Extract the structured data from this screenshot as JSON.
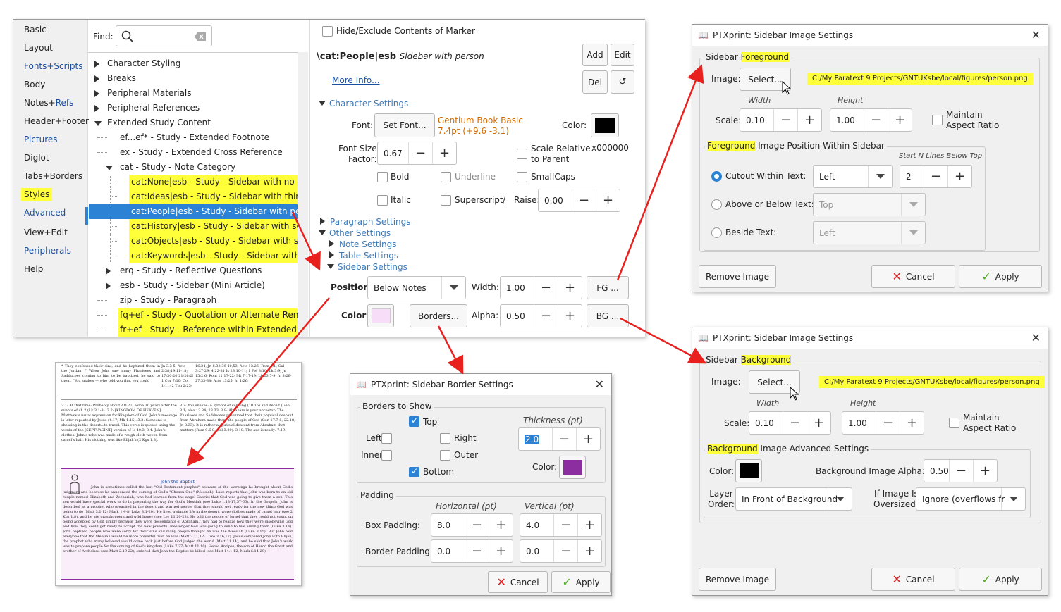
{
  "sidebar_nav": {
    "items": [
      {
        "label": "Basic",
        "color": "dark"
      },
      {
        "label": "Layout",
        "color": "dark"
      },
      {
        "label": "Fonts+Scripts",
        "color": "blue"
      },
      {
        "label": "Body",
        "color": "dark"
      },
      {
        "label": "Notes+Refs",
        "color": "mixed"
      },
      {
        "label": "Header+Footer",
        "color": "dark"
      },
      {
        "label": "Pictures",
        "color": "blue"
      },
      {
        "label": "Diglot",
        "color": "dark"
      },
      {
        "label": "Tabs+Borders",
        "color": "dark"
      },
      {
        "label": "Styles",
        "color": "highlight"
      },
      {
        "label": "Advanced",
        "color": "blue"
      },
      {
        "label": "View+Edit",
        "color": "dark"
      },
      {
        "label": "Peripherals",
        "color": "blue"
      },
      {
        "label": "Help",
        "color": "dark"
      }
    ],
    "notes_part1": "Notes+",
    "notes_part2": "Refs"
  },
  "find": {
    "label": "Find:",
    "value": ""
  },
  "tree": [
    {
      "label": "Character Styling",
      "level": 0,
      "exp": "closed"
    },
    {
      "label": "Breaks",
      "level": 0,
      "exp": "closed"
    },
    {
      "label": "Peripheral Materials",
      "level": 0,
      "exp": "closed"
    },
    {
      "label": "Peripheral References",
      "level": 0,
      "exp": "closed"
    },
    {
      "label": "Extended Study Content",
      "level": 0,
      "exp": "open"
    },
    {
      "label": "ef...ef* - Study - Extended Footnote",
      "level": 1,
      "exp": "none"
    },
    {
      "label": "ex - Study - Extended Cross Reference",
      "level": 1,
      "exp": "none"
    },
    {
      "label": "cat - Study - Note Category",
      "level": 1,
      "exp": "open"
    },
    {
      "label": "cat:None|esb - Study - Sidebar with no imag",
      "level": 2,
      "exp": "none",
      "hl": true
    },
    {
      "label": "cat:Ideas|esb - Study - Sidebar with thinking",
      "level": 2,
      "exp": "none",
      "hl": true
    },
    {
      "label": "cat:People|esb - Study - Sidebar with person",
      "level": 2,
      "exp": "none",
      "sel": true
    },
    {
      "label": "cat:History|esb - Study - Sidebar with scroll E",
      "level": 2,
      "exp": "none",
      "hl": true
    },
    {
      "label": "cat:Objects|esb - Study - Sidebar with shapes",
      "level": 2,
      "exp": "none",
      "hl": true
    },
    {
      "label": "cat:Keywords|esb - Study - Sidebar with key",
      "level": 2,
      "exp": "none",
      "hl": true
    },
    {
      "label": "erq - Study - Reflective Questions",
      "level": 1,
      "exp": "closed"
    },
    {
      "label": "esb - Study - Sidebar (Mini Article)",
      "level": 1,
      "exp": "closed"
    },
    {
      "label": "zip - Study - Paragraph",
      "level": 1,
      "exp": "none"
    },
    {
      "label": "fq+ef - Study - Quotation or Alternate Rendering",
      "level": 1,
      "exp": "none",
      "hl": true
    },
    {
      "label": "fr+ef - Study - Reference within Extended Footn",
      "level": 1,
      "exp": "none",
      "hl": true
    }
  ],
  "style_panel": {
    "hide_label": "Hide/Exclude Contents of Marker",
    "marker": "\\cat:People|esb",
    "marker_desc": "Sidebar with person",
    "add": "Add",
    "edit": "Edit",
    "del": "Del",
    "more_info": "More Info...",
    "char_settings": "Character Settings",
    "font_label": "Font:",
    "set_font": "Set Font...",
    "font_name": "Gentium Book Basic",
    "font_size": "7.4pt (+9.6 -3.1)",
    "color_label": "Color:",
    "color_hex": "x000000",
    "font_size_factor": "Font Size\nFactor:",
    "fsf_value": "0.67",
    "scale_relative": "Scale Relative\nto Parent",
    "bold": "Bold",
    "underline": "Underline",
    "smallcaps": "SmallCaps",
    "italic": "Italic",
    "superscript": "Superscript",
    "slash": "/",
    "raise": "Raise:",
    "raise_value": "0.00",
    "para_settings": "Paragraph Settings",
    "other_settings": "Other Settings",
    "note_settings": "Note Settings",
    "table_settings": "Table Settings",
    "sidebar_settings": "Sidebar Settings",
    "position_label": "Position:",
    "position_value": "Below Notes",
    "width_label": "Width:",
    "width_value": "1.00",
    "fg_btn": "FG ...",
    "color2_label": "Color:",
    "borders_btn": "Borders...",
    "alpha_label": "Alpha:",
    "alpha_value": "0.50",
    "bg_btn": "BG ..."
  },
  "fg_dialog": {
    "title": "PTXprint: Sidebar Image Settings",
    "group1_a": "Sidebar ",
    "group1_b": "Foreground",
    "image_label": "Image:",
    "select": "Select...",
    "path": "C:/My Paratext 9 Projects/GNTUKsbe/local/figures/person.png",
    "width_hdr": "Width",
    "height_hdr": "Height",
    "scale_label": "Scale:",
    "scale_w": "0.10",
    "scale_h": "1.00",
    "maintain": "Maintain\nAspect Ratio",
    "group2_a": "Foreground",
    "group2_b": " Image Position Within Sidebar",
    "start_n": "Start N Lines Below Top",
    "cutout": "Cutout Within Text:",
    "cutout_val": "Left",
    "cutout_n": "2",
    "above": "Above or Below Text:",
    "above_val": "Top",
    "beside": "Beside Text:",
    "beside_val": "Left",
    "remove": "Remove Image",
    "cancel": "Cancel",
    "apply": "Apply"
  },
  "bg_dialog": {
    "title": "PTXprint: Sidebar Image Settings",
    "group1_a": "Sidebar ",
    "group1_b": "Background",
    "image_label": "Image:",
    "select": "Select...",
    "path": "C:/My Paratext 9 Projects/GNTUKsbe/local/figures/person.png",
    "width_hdr": "Width",
    "height_hdr": "Height",
    "scale_label": "Scale:",
    "scale_w": "0.10",
    "scale_h": "1.00",
    "maintain": "Maintain\nAspect Ratio",
    "group2_a": "Background",
    "group2_b": " Image Advanced Settings",
    "color_label": "Color:",
    "alpha_label": "Background Image Alpha:",
    "alpha_val": "0.50",
    "layer_label": "Layer\nOrder:",
    "layer_val": "In Front of Background",
    "oversize_label": "If Image Is\nOversized:",
    "oversize_val": "Ignore (overflows fr",
    "remove": "Remove Image",
    "cancel": "Cancel",
    "apply": "Apply"
  },
  "border_dialog": {
    "title": "PTXprint: Sidebar Border Settings",
    "group1": "Borders to Show",
    "top": "Top",
    "left": "Left",
    "right": "Right",
    "inner": "Inner",
    "outer": "Outer",
    "bottom": "Bottom",
    "thickness": "Thickness (pt)",
    "thickness_val": "2.0",
    "color_label": "Color:",
    "padding": "Padding",
    "horizontal": "Horizontal (pt)",
    "vertical": "Vertical (pt)",
    "box_padding": "Box Padding:",
    "box_h": "8.0",
    "box_v": "4.0",
    "border_padding": "Border Padding:",
    "border_h": "0.0",
    "border_v": "0.0",
    "cancel": "Cancel",
    "apply": "Apply"
  },
  "doc_preview": {
    "sidebar_title": "John the Baptist",
    "top_left": "* They confessed their sins, and he baptized them in the Jordan. ⁷ When John saw many Pharisees and Sadducees coming to him to be baptized, he said to them, \"You snakes — who told you that you could",
    "top_right": "Jn 3:3-5; Acts 2:38;19:11-18; 17:30;20:21;26:20; 1 Cor 7:10; Col 1:11; 2 Tim 2:25;",
    "far_right": "16:24; Jn 8:33,39-40,53; Acts 13:26; Rom 4:1; Gal 3:27-29; 4:22-31 Is 28:10-11; 1 Pet 3:10; Lk 3:9; Jn 15:2,6; Rom 11:17-22; Mt 7:17-19; Lk 13:7-9; Jn 8:26-27,33-34; Acts 13:25; Jn 1:26;",
    "notes_left": "3.1: At that time: Probably about AD 27, some 30 years after the events of ch 2 (Lk 3.1-3). 3.2: [KINGDOM OF HEAVEN]: Matthew's usual expression for Kingdom of God. John's message is later repeated by Jesus (4.17; Mk 1.15). 3.3: Someone is shouting in the desert...to travel: This verse is quoted using the words of the [SEPTUAGINT] version of Is 40.3. 3.4: John's clothes: John's robe was made of a rough cloth woven from camel's hair. His clothing was like Elijah's (2 Kgs 1.8).",
    "notes_right": "3.7: You snakes: A symbol of cunning (10.16) and deceit (Gen 3.1; also 12.34; 23.33. 3.9: Abraham is your ancestor: The Pharisees and Sadducees presumed that their physical descent from Abraham made them the people of God (Gen 17.7-8; 22.18; Jn 8.33). It is rather a spiritual descent from Abraham that matters (Rom 9.6-8; Gal 3.29). 3.10: The axe is ready: 7.19.",
    "sidebar_text": "John is sometimes called the last \"Old Testament prophet\" because of the warnings he brought about God's judgment and because he announced the coming of God's \"Chosen One\" (Messiah). Luke reports that John was born to an old couple named Elizabeth and Zechariah, who had learned from the angel Gabriel that God was going to give them a son. This son would have special work to do in preparing the way for God's Messiah (see Luke 1.13-17,57-66). In the Gospels, John is described as a prophet who preached in the desert and warned people that they should get ready for the new thing God was going to do (Matt 3.1-12; Mark 1.4-8; Luke 3.1-20). He lived a simple life in the desert, wore clothes made of camel hair (see 2 Kgs 1.8), and he ate grasshoppers and wild honey (see Lev 11.20-23). He told the people of Israel that they could not count on being accepted by God simply because they were descendants of Abraham. They had to realize how they were disobeying God and how they could get ready to accept the new powerful messenger God was going to send to live among them (Luke 3.16). John baptized people who were sorry for their sins and many people thought he was the Messiah (Luke 3.15). But John told everyone that the Messiah would be more powerful than he was (Matt 3.11,12; Luke 3.16,17). Jesus compared John with Elijah, the prophet who many believed would come back just before God judged the world (Matt 11.14), and he said that John's work was to prepare people for the coming of God's kingdom (Luke 7.27; Matt 11.10). Herod Antipas, the son of Herod the Great and brother of Archelaus (see Matt 2.19-22), ordered that John the Baptist be killed (see Matt 14.1-12; Mark 6.14-29)."
  },
  "colors": {
    "accent": "#2c82d4",
    "highlight": "#ffff3a",
    "selection": "#2c82d4",
    "arrow": "#e8201e",
    "orange_text": "#d06a00",
    "sidebar_purple": "#8c2da0",
    "sidebar_bg": "#f7ddf7"
  }
}
